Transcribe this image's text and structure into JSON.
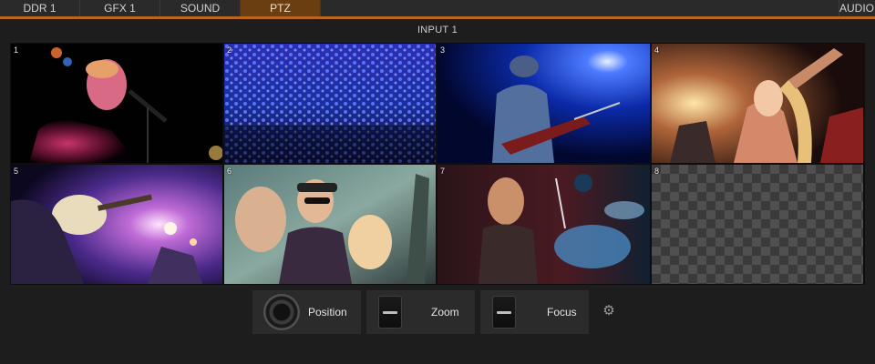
{
  "tabs": [
    {
      "label": "DDR 1",
      "active": false
    },
    {
      "label": "GFX 1",
      "active": false
    },
    {
      "label": "SOUND",
      "active": false
    },
    {
      "label": "PTZ",
      "active": true
    },
    {
      "label": "AUDIO",
      "active": false
    }
  ],
  "input_title": "INPUT 1",
  "presets": [
    {
      "number": "1",
      "content": "singer-at-microphone"
    },
    {
      "number": "2",
      "content": "concert-crowd"
    },
    {
      "number": "3",
      "content": "guitarist-on-stage"
    },
    {
      "number": "4",
      "content": "cheering-fans"
    },
    {
      "number": "5",
      "content": "guitar-closeup-stage-lights"
    },
    {
      "number": "6",
      "content": "friends-celebrating"
    },
    {
      "number": "7",
      "content": "drummer"
    },
    {
      "number": "8",
      "content": "empty"
    }
  ],
  "controls": {
    "position_label": "Position",
    "zoom_label": "Zoom",
    "focus_label": "Focus"
  },
  "icons": {
    "settings": "gear-icon"
  },
  "colors": {
    "accent": "#b9651f",
    "active_tab": "#6b3e12",
    "background": "#1d1d1d"
  }
}
